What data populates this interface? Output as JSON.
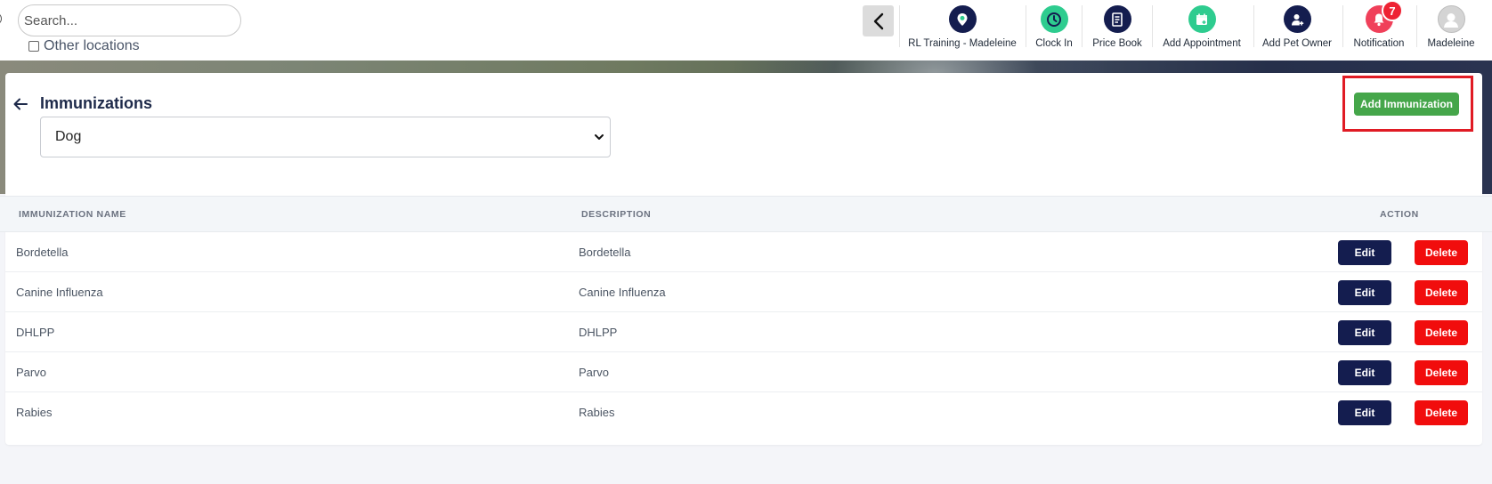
{
  "search": {
    "placeholder": "Search..."
  },
  "other_locations": {
    "label": "Other locations",
    "checked": false
  },
  "nav": [
    {
      "label": "RL Training - Madeleine",
      "icon": "location-pin-icon",
      "color": "#141d4f"
    },
    {
      "label": "Clock In",
      "icon": "clock-icon",
      "color": "#2ecc8f"
    },
    {
      "label": "Price Book",
      "icon": "document-icon",
      "color": "#141d4f"
    },
    {
      "label": "Add Appointment",
      "icon": "calendar-plus-icon",
      "color": "#2ecc8f"
    },
    {
      "label": "Add Pet Owner",
      "icon": "user-plus-icon",
      "color": "#141d4f"
    },
    {
      "label": "Notification",
      "icon": "bell-icon",
      "color": "#f0405a",
      "badge": "7"
    },
    {
      "label": "Madeleine",
      "icon": "avatar-icon",
      "color": "#cfcfcf"
    }
  ],
  "page": {
    "title": "Immunizations",
    "species": "Dog",
    "add_button": "Add Immunization"
  },
  "table": {
    "headers": [
      "IMMUNIZATION NAME",
      "DESCRIPTION",
      "ACTION"
    ],
    "rows": [
      {
        "name": "Bordetella",
        "description": "Bordetella"
      },
      {
        "name": "Canine Influenza",
        "description": "Canine Influenza"
      },
      {
        "name": "DHLPP",
        "description": "DHLPP"
      },
      {
        "name": "Parvo",
        "description": "Parvo"
      },
      {
        "name": "Rabies",
        "description": "Rabies"
      }
    ],
    "edit_label": "Edit",
    "delete_label": "Delete"
  },
  "colors": {
    "navy": "#141d4f",
    "green": "#45a64a",
    "red": "#f10d0d",
    "highlight": "#e01b24"
  }
}
